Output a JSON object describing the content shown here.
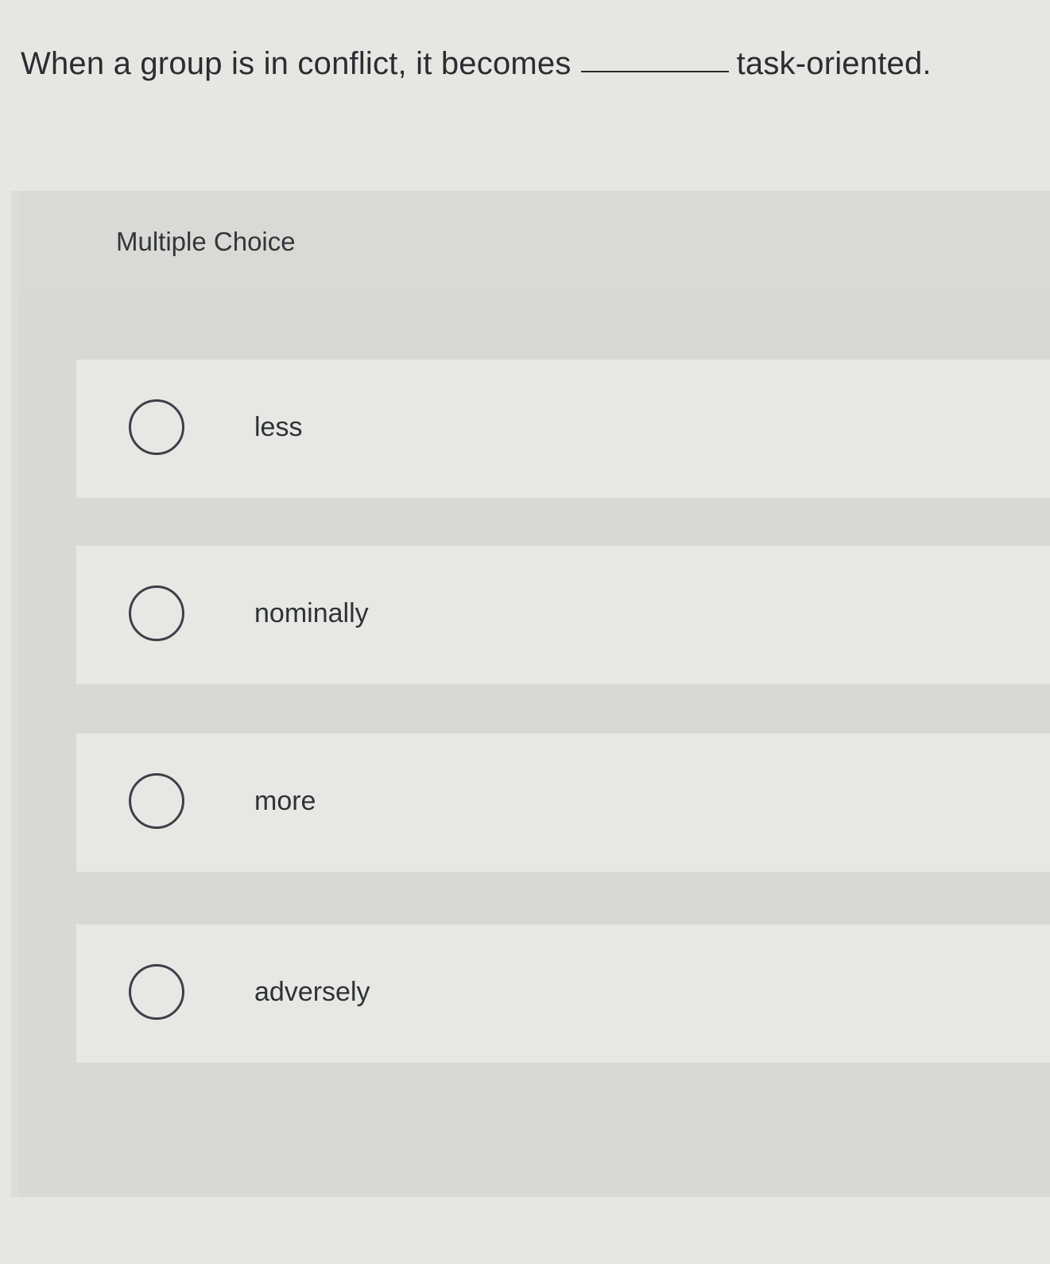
{
  "question": {
    "before_blank": "When a group is in conflict, it becomes",
    "after_blank": "task-oriented."
  },
  "section": {
    "label": "Multiple Choice"
  },
  "options": [
    {
      "label": "less",
      "selected": false
    },
    {
      "label": "nominally",
      "selected": false
    },
    {
      "label": "more",
      "selected": false
    },
    {
      "label": "adversely",
      "selected": false
    }
  ]
}
